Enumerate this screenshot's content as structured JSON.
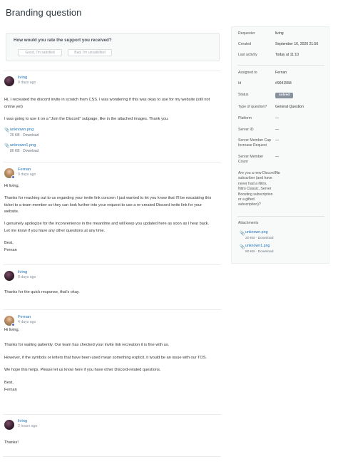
{
  "page": {
    "title": "Branding question"
  },
  "satisfaction": {
    "question": "How would you rate the support you received?",
    "good_label": "Good, I'm satisfied",
    "bad_label": "Bad, I'm unsatisfied"
  },
  "comments": [
    {
      "author": "living",
      "time": "9 days ago",
      "paragraphs": [
        "Hi, I recreated the discord invite in scratch from CSS. I was wondering if this was okay to use for my website (still not online yet)",
        "I was going to use it on a \"Join the Discord\" subpage, like in the attached images. Thank you."
      ],
      "attachments": [
        {
          "name": "unknown.png",
          "size": "20 KB",
          "download": "Download"
        },
        {
          "name": "unknown1.png",
          "size": "80 KB",
          "download": "Download"
        }
      ]
    },
    {
      "author": "Fernan",
      "time": "9 days ago",
      "paragraphs": [
        "Hi living,",
        "Thanks for reaching out to us regarding your invite link concern I just wanted to let you know that I'll be escalating this ticket to a team member so they can look further into your request to use a re-created Discord invite link for your website.",
        "I genuinely apologize for the inconvenience in the meantime and will keep you updated here as soon as I hear back. Let me know if you have any other questions at any time.",
        "Best,",
        "Fernan"
      ]
    },
    {
      "author": "living",
      "time": "8 days ago",
      "paragraphs": [
        "Thanks for the quick response, that's okay."
      ]
    },
    {
      "author": "Fernan",
      "time": "4 days ago",
      "paragraphs": [
        "Hi living,",
        "Thanks for waiting patiently. Our team has checked your invite link recreation it is fine with us.",
        "However, if the symbols or letters that have been used mean something explicit, it would be an issue with our TOS.",
        "We hope this helps. Please let us know here if you have other Discord-related questions.",
        "Best,",
        "Fernan"
      ]
    },
    {
      "author": "living",
      "time": "2 hours ago",
      "paragraphs": [
        "Thanks!"
      ]
    }
  ],
  "sidebar": {
    "requester_label": "Requester",
    "requester_value": "living",
    "created_label": "Created",
    "created_value": "September 16, 2020 21:56",
    "last_activity_label": "Last activity",
    "last_activity_value": "Today at 11:10",
    "assigned_label": "Assigned to",
    "assigned_value": "Fernan",
    "id_label": "Id",
    "id_value": "#9041558",
    "status_label": "Status",
    "status_value": "solved",
    "type_label": "Type of question?",
    "type_value": "General Question",
    "platform_label": "Platform",
    "platform_value": "—",
    "server_id_label": "Server ID",
    "server_id_value": "—",
    "server_cap_label": "Server Member Cap Increase Request",
    "server_cap_value": "—",
    "server_count_label": "Server Member Count",
    "server_count_value": "—",
    "new_sub_label": "Are you a new Discord subscriber (and have never had a Nitro, Nitro Classic, Server Boosting subscription or a gifted subscription)?",
    "new_sub_value": "No",
    "attachments_label": "Attachments",
    "attachments": [
      {
        "name": "unknown.png",
        "size": "20 KB",
        "download": "Download"
      },
      {
        "name": "unknown1.png",
        "size": "80 KB",
        "download": "Download"
      }
    ]
  },
  "icons": {
    "attachment": "paperclip-icon",
    "staff_badge": "staff-badge-icon"
  },
  "colors": {
    "link": "#1f73b7",
    "solved_badge": "#87929d",
    "title": "#2f3941"
  }
}
